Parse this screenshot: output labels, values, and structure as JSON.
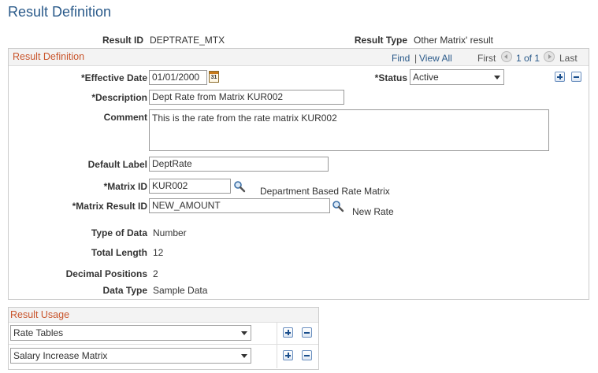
{
  "page": {
    "title": "Result Definition"
  },
  "header": {
    "result_id_label": "Result ID",
    "result_id_value": "DEPTRATE_MTX",
    "result_type_label": "Result Type",
    "result_type_value": "Other Matrix' result"
  },
  "definition": {
    "title": "Result Definition",
    "find": "Find",
    "separator": "|",
    "view_all": "View All",
    "first": "First",
    "count": "1 of 1",
    "last": "Last",
    "effective_date_label": "*Effective Date",
    "effective_date_value": "01/01/2000",
    "status_label": "*Status",
    "status_value": "Active",
    "description_label": "*Description",
    "description_value": "Dept Rate from Matrix KUR002",
    "comment_label": "Comment",
    "comment_value": "This is the rate from the rate matrix KUR002",
    "default_label_label": "Default Label",
    "default_label_value": "DeptRate",
    "matrix_id_label": "*Matrix ID",
    "matrix_id_value": "KUR002",
    "matrix_id_desc": "Department Based Rate Matrix",
    "matrix_result_id_label": "*Matrix Result ID",
    "matrix_result_id_value": "NEW_AMOUNT",
    "matrix_result_id_desc": "New Rate",
    "type_of_data_label": "Type of Data",
    "type_of_data_value": "Number",
    "total_length_label": "Total Length",
    "total_length_value": "12",
    "decimal_positions_label": "Decimal Positions",
    "decimal_positions_value": "2",
    "data_type_label": "Data Type",
    "data_type_value": "Sample Data",
    "calendar_icon_text": "31"
  },
  "usage": {
    "title": "Result Usage",
    "rows": [
      {
        "value": "Rate Tables"
      },
      {
        "value": "Salary Increase Matrix"
      }
    ]
  },
  "colors": {
    "title_blue": "#2a5a8a",
    "section_orange": "#c9552c",
    "button_blue": "#1a4e8c"
  },
  "icons": [
    "calendar-icon",
    "search-icon",
    "add-row-icon",
    "delete-row-icon",
    "chevron-left-icon",
    "chevron-right-icon",
    "dropdown-caret-icon"
  ]
}
